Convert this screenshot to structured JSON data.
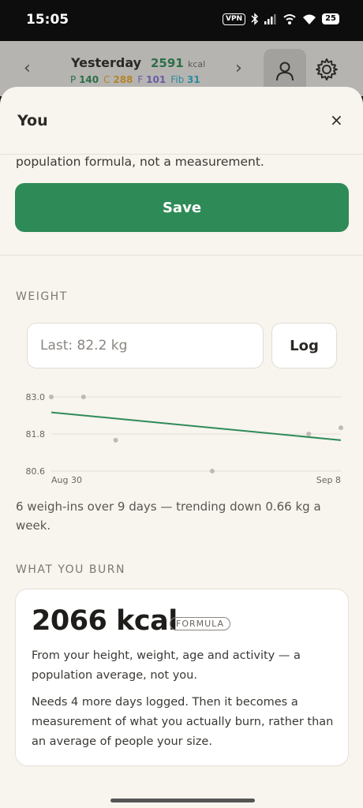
{
  "status_bar": {
    "time": "15:05",
    "vpn": "VPN",
    "battery": "25"
  },
  "header": {
    "prev_arrow": "‹",
    "next_arrow": "›",
    "day_label": "Yesterday",
    "separator": "·",
    "kcal_value": "2591",
    "kcal_unit": "kcal",
    "macros": [
      {
        "prefix": "P",
        "value": "140"
      },
      {
        "prefix": "C",
        "value": "288"
      },
      {
        "prefix": "F",
        "value": "101"
      },
      {
        "prefix": "Fib",
        "value": "31"
      }
    ]
  },
  "sheet": {
    "title": "You",
    "close": "×",
    "formula_tail": "population formula, not a measurement.",
    "save_label": "Save"
  },
  "weight": {
    "section_label": "WEIGHT",
    "input_placeholder": "Last: 82.2 kg",
    "log_label": "Log",
    "trend_text": "6 weigh-ins over 9 days — trending down 0.66 kg a week."
  },
  "chart_data": {
    "type": "scatter",
    "y_ticks": [
      "83.0",
      "81.8",
      "80.6"
    ],
    "ylim": [
      80.6,
      83.0
    ],
    "x_labels": [
      "Aug 30",
      "Sep 8"
    ],
    "points": [
      {
        "day": 0,
        "weight": 83.0
      },
      {
        "day": 1,
        "weight": 83.0
      },
      {
        "day": 2,
        "weight": 81.6
      },
      {
        "day": 5,
        "weight": 80.6
      },
      {
        "day": 8,
        "weight": 81.8
      },
      {
        "day": 9,
        "weight": 82.0
      }
    ],
    "trend_line": {
      "start": 82.5,
      "end": 81.6
    },
    "colors": {
      "trend": "#2e8b57",
      "point": "#bfbab2",
      "grid": "#e4dfd7"
    }
  },
  "burn": {
    "section_label": "WHAT YOU BURN",
    "value": "2066 kcal",
    "badge": "FORMULA",
    "desc1": "From your height, weight, age and activity — a population average, not you.",
    "desc2": "Needs 4 more days logged. Then it becomes a measurement of what you actually burn, rather than an average of people your size."
  },
  "colors": {
    "accent": "#2e8b57",
    "sheet_bg": "#f8f4ee"
  }
}
